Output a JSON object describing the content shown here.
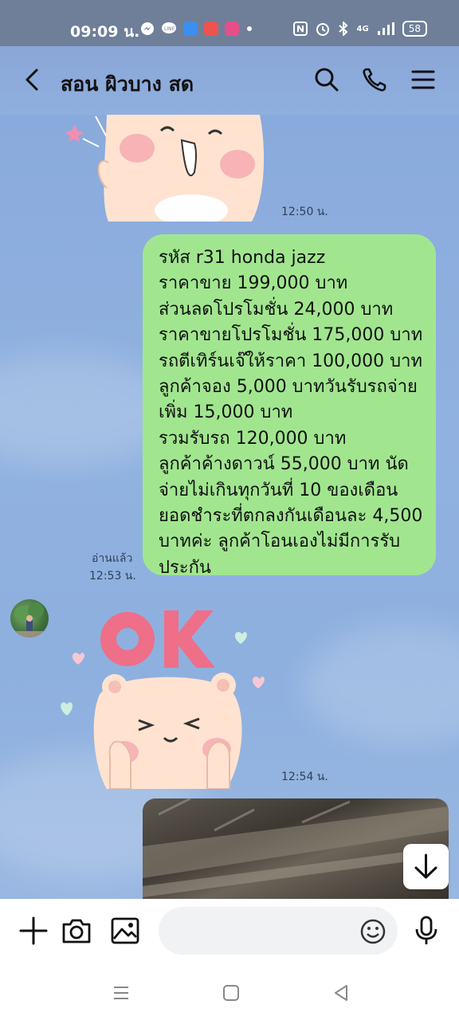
{
  "status_bar": {
    "time": "09:09 น.",
    "battery": "58",
    "network": "4G"
  },
  "header": {
    "title": "สอน ผิวบาง สด"
  },
  "messages": {
    "sticker1_time": "12:50 น.",
    "bubble_text": "รหัส r31 honda jazz\nราคาขาย 199,000 บาท\nส่วนลดโปรโมชั่น 24,000 บาท\nราคาขายโปรโมชั่น 175,000 บาท\nรถตีเทิร์นเจ๊ให้ราคา 100,000 บาท\nลูกค้าจอง 5,000 บาทวันรับรถจ่าย\nเพิ่ม 15,000 บาท\nรวมรับรถ 120,000 บาท\nลูกค้าค้างดาวน์ 55,000 บาท นัด\nจ่ายไม่เกินทุกวันที่ 10 ของเดือน\nยอดชำระที่ตกลงกันเดือนละ 4,500\nบาทค่ะ ลูกค้าโอนเองไม่มีการรับ\nประกัน",
    "read_label": "อ่านแล้ว",
    "bubble_time": "12:53 น.",
    "sticker2_word": "OK",
    "sticker2_time": "12:54 น."
  },
  "colors": {
    "bubble": "#a1e68f",
    "background": "#8fb0df",
    "status_bar": "#6f7f99"
  },
  "icons": [
    "back-arrow-icon",
    "search-icon",
    "phone-icon",
    "menu-icon",
    "plus-icon",
    "camera-icon",
    "image-icon",
    "emoji-icon",
    "microphone-icon",
    "arrow-down-icon"
  ]
}
